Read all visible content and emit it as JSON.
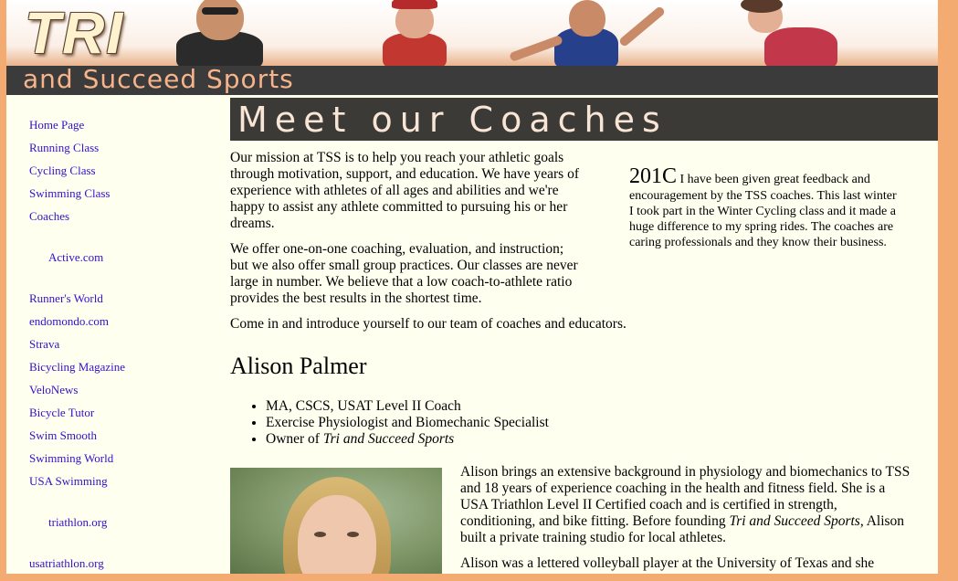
{
  "header": {
    "logo_tri": "TRI",
    "tagline": "and Succeed Sports"
  },
  "sidebar": {
    "links": [
      "Home Page",
      "Running Class",
      "Cycling Class",
      "Swimming Class",
      "Coaches"
    ],
    "ext1": [
      "Active.com"
    ],
    "ext2": [
      "Runner's World",
      "endomondo.com",
      "Strava",
      "Bicycling Magazine",
      "VeloNews",
      "Bicycle Tutor",
      "Swim Smooth",
      "Swimming World",
      "USA Swimming"
    ],
    "ext3": [
      "triathlon.org"
    ],
    "ext4": [
      "usatriathlon.org"
    ]
  },
  "main": {
    "title": "Meet our Coaches",
    "intro_p1": "Our mission at TSS is to help you reach your athletic goals through motivation, support, and education. We have years of experience with athletes of all ages and abilities and we're happy to assist any athlete committed to pursuing his or her dreams.",
    "intro_p2": "We offer one-on-one coaching, evaluation, and instruction; but we also offer small group practices. Our classes are never large in number. We believe that a low coach-to-athlete ratio provides the best results in the shortest time.",
    "intro_p3": "Come in and introduce yourself to our team of coaches and educators.",
    "testimonial_big": "201C",
    "testimonial_text": " I have been given great feedback and encouragement by the TSS coaches. This last winter I took part in the Winter Cycling class and it made a huge difference to my spring rides. The coaches are caring professionals and they know their business.",
    "coach_name": "Alison Palmer",
    "credentials": [
      "MA, CSCS, USAT Level II Coach",
      "Exercise Physiologist and Biomechanic Specialist"
    ],
    "cred3_prefix": "Owner of ",
    "cred3_em": "Tri and Succeed Sports",
    "bio1_a": "Alison brings an extensive background in physiology and biomechanics to TSS and 18 years of experience coaching in the health and fitness field. She is a USA Triathlon Level II Certified coach and is certified in strength, conditioning, and bike fitting. Before founding ",
    "bio1_em": "Tri and Succeed Sports",
    "bio1_b": ", Alison built a private training studio for local athletes.",
    "bio2": "Alison was a lettered volleyball player at the University of Texas and she"
  },
  "colors": {
    "outer": "#f3ab72",
    "content_bg": "#fffff0",
    "dark_bar": "#3b3b3b",
    "tagline": "#f7b48a",
    "link": "#3311cc"
  }
}
